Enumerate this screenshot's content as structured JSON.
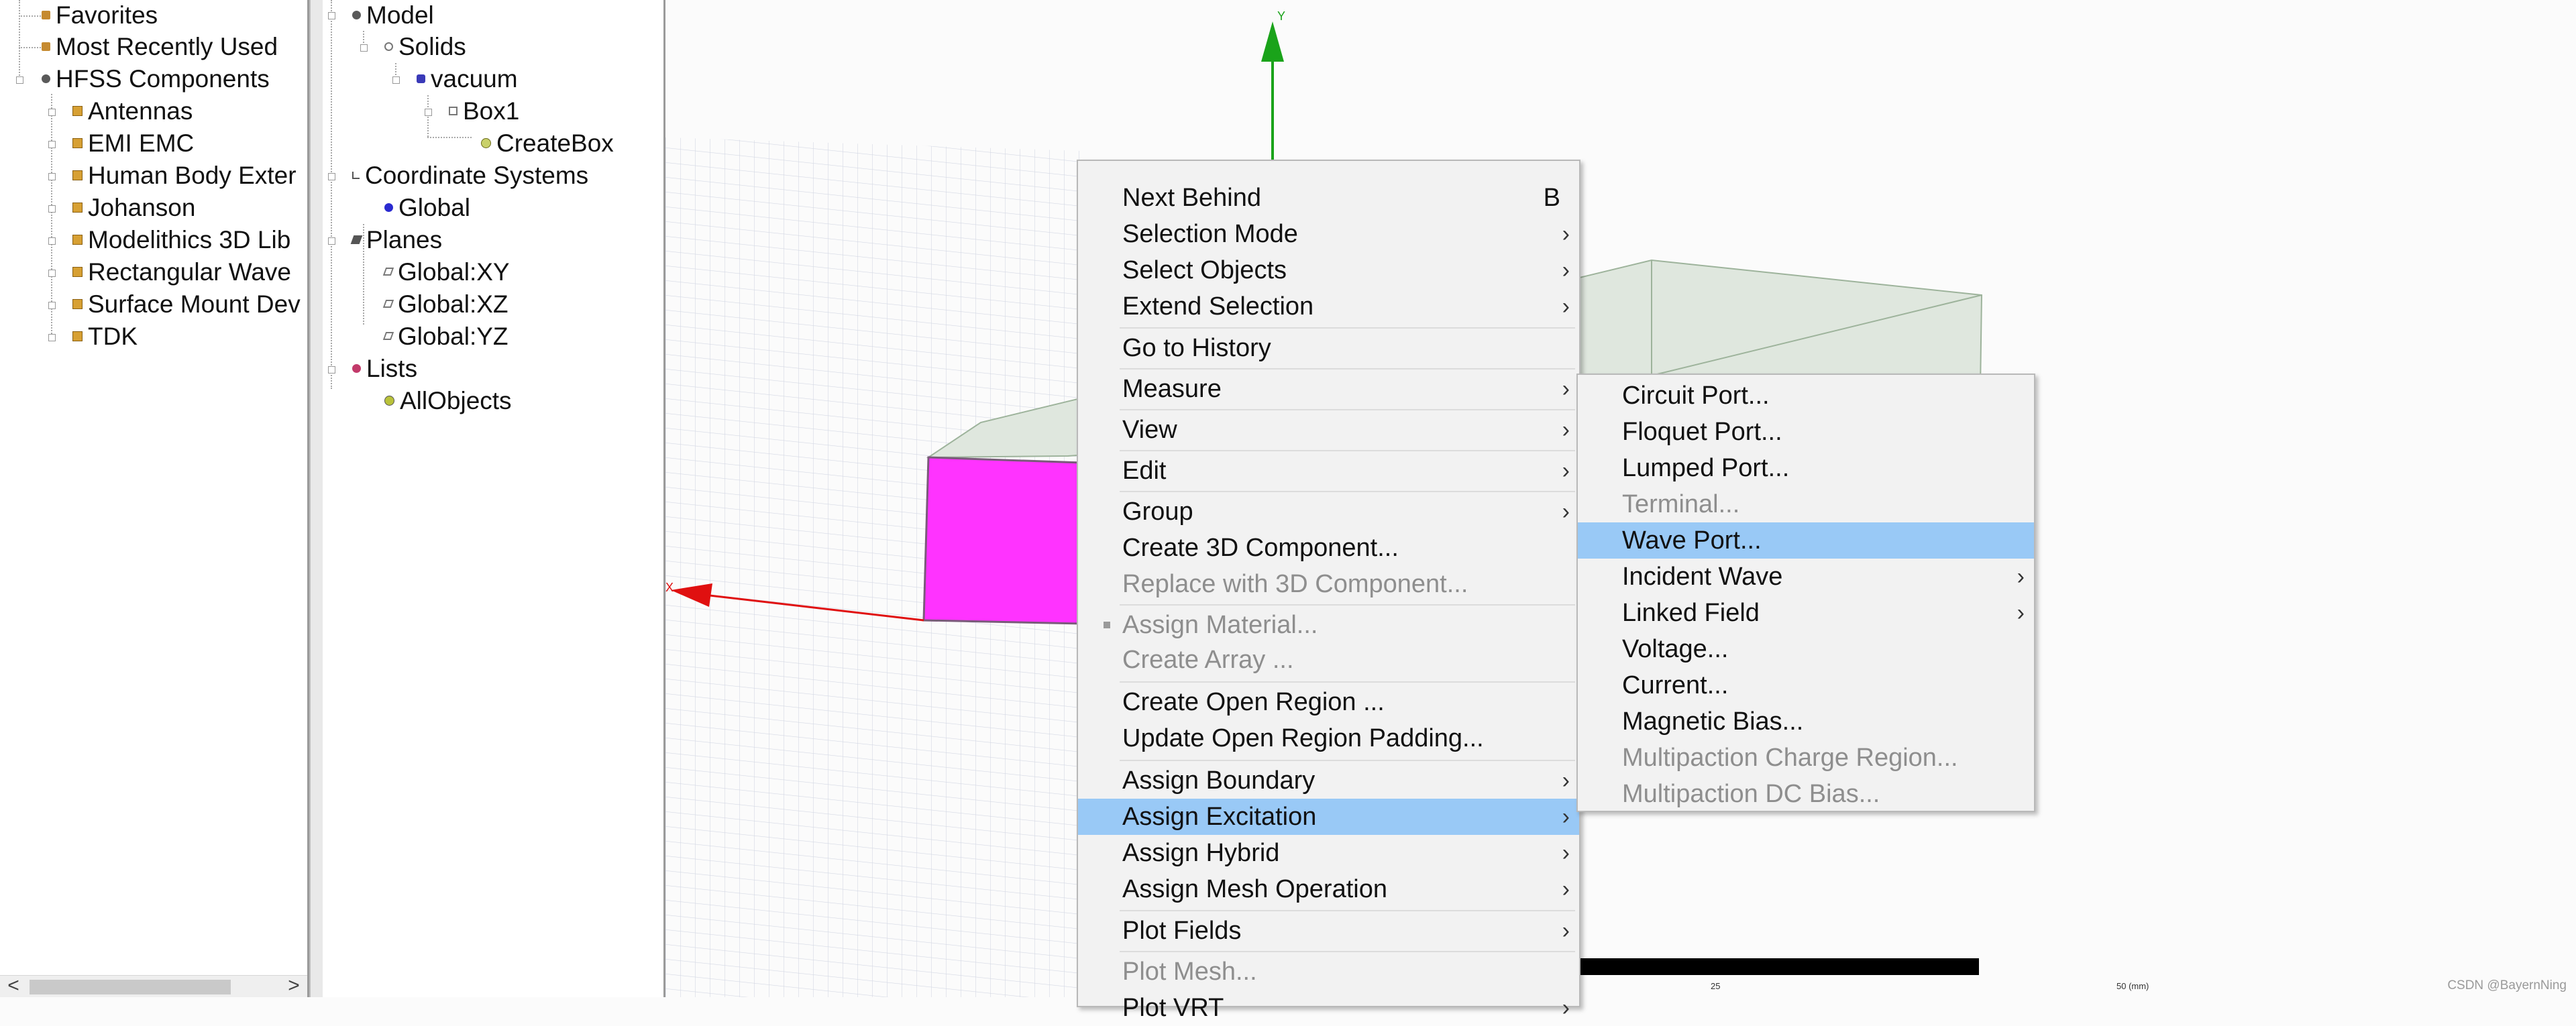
{
  "library_tree": {
    "items": [
      {
        "label": "Favorites",
        "icon": "star-icon"
      },
      {
        "label": "Most Recently Used",
        "icon": "star-icon"
      },
      {
        "label": "HFSS Components",
        "icon": "component-icon"
      },
      {
        "label": "Antennas",
        "icon": "folder-icon"
      },
      {
        "label": "EMI EMC",
        "icon": "folder-icon"
      },
      {
        "label": "Human Body Exter",
        "icon": "folder-icon"
      },
      {
        "label": "Johanson",
        "icon": "folder-icon"
      },
      {
        "label": "Modelithics 3D Lib",
        "icon": "folder-icon"
      },
      {
        "label": "Rectangular Wave",
        "icon": "folder-icon"
      },
      {
        "label": "Surface Mount Dev",
        "icon": "folder-icon"
      },
      {
        "label": "TDK",
        "icon": "folder-icon"
      }
    ],
    "scroll_left": "<",
    "scroll_right": ">"
  },
  "model_tree": {
    "items": [
      {
        "label": "Model",
        "icon": "model-icon"
      },
      {
        "label": "Solids",
        "icon": "solids-icon"
      },
      {
        "label": "vacuum",
        "icon": "material-icon"
      },
      {
        "label": "Box1",
        "icon": "box-icon"
      },
      {
        "label": "CreateBox",
        "icon": "operation-icon"
      },
      {
        "label": "Coordinate Systems",
        "icon": "coordinate-icon"
      },
      {
        "label": "Global",
        "icon": "global-cs-icon"
      },
      {
        "label": "Planes",
        "icon": "planes-icon"
      },
      {
        "label": "Global:XY",
        "icon": "plane-icon"
      },
      {
        "label": "Global:XZ",
        "icon": "plane-icon"
      },
      {
        "label": "Global:YZ",
        "icon": "plane-icon"
      },
      {
        "label": "Lists",
        "icon": "lists-icon"
      },
      {
        "label": "AllObjects",
        "icon": "list-item-icon"
      }
    ]
  },
  "viewport": {
    "y_axis_label": "Y",
    "x_axis_label": "X",
    "box_face_color": "#ff33ff",
    "scale_label_mid": "25",
    "scale_label_end": "50 (mm)",
    "watermark": "CSDN @BayernNing"
  },
  "context_menu": {
    "items": [
      {
        "label": "Next Behind",
        "accel": "B"
      },
      {
        "label": "Selection Mode",
        "submenu": true
      },
      {
        "label": "Select Objects",
        "submenu": true
      },
      {
        "label": "Extend Selection",
        "submenu": true
      },
      {
        "label": "Go to History"
      },
      {
        "label": "Measure",
        "submenu": true
      },
      {
        "label": "View",
        "submenu": true
      },
      {
        "label": "Edit",
        "submenu": true
      },
      {
        "label": "Group",
        "submenu": true
      },
      {
        "label": "Create 3D Component..."
      },
      {
        "label": "Replace with 3D Component...",
        "disabled": true
      },
      {
        "label": "Assign Material...",
        "disabled": true
      },
      {
        "label": "Create Array ...",
        "disabled": true
      },
      {
        "label": "Create Open Region ..."
      },
      {
        "label": "Update Open Region Padding..."
      },
      {
        "label": "Assign Boundary",
        "submenu": true
      },
      {
        "label": "Assign Excitation",
        "submenu": true,
        "highlighted": true
      },
      {
        "label": "Assign Hybrid",
        "submenu": true
      },
      {
        "label": "Assign Mesh Operation",
        "submenu": true
      },
      {
        "label": "Plot Fields",
        "submenu": true
      },
      {
        "label": "Plot Mesh...",
        "disabled": true
      },
      {
        "label": "Plot VRT",
        "submenu": true
      }
    ],
    "submenu_arrow": "›"
  },
  "excitation_submenu": {
    "items": [
      {
        "label": "Circuit Port..."
      },
      {
        "label": "Floquet Port..."
      },
      {
        "label": "Lumped Port..."
      },
      {
        "label": "Terminal...",
        "disabled": true
      },
      {
        "label": "Wave Port...",
        "highlighted": true
      },
      {
        "label": "Incident Wave",
        "submenu": true
      },
      {
        "label": "Linked Field",
        "submenu": true
      },
      {
        "label": "Voltage..."
      },
      {
        "label": "Current..."
      },
      {
        "label": "Magnetic Bias..."
      },
      {
        "label": "Multipaction Charge Region...",
        "disabled": true
      },
      {
        "label": "Multipaction DC Bias...",
        "disabled": true
      }
    ]
  },
  "colors": {
    "highlight": "#99c9f6",
    "y_axis": "#1aa31a",
    "x_axis": "#e01010"
  }
}
